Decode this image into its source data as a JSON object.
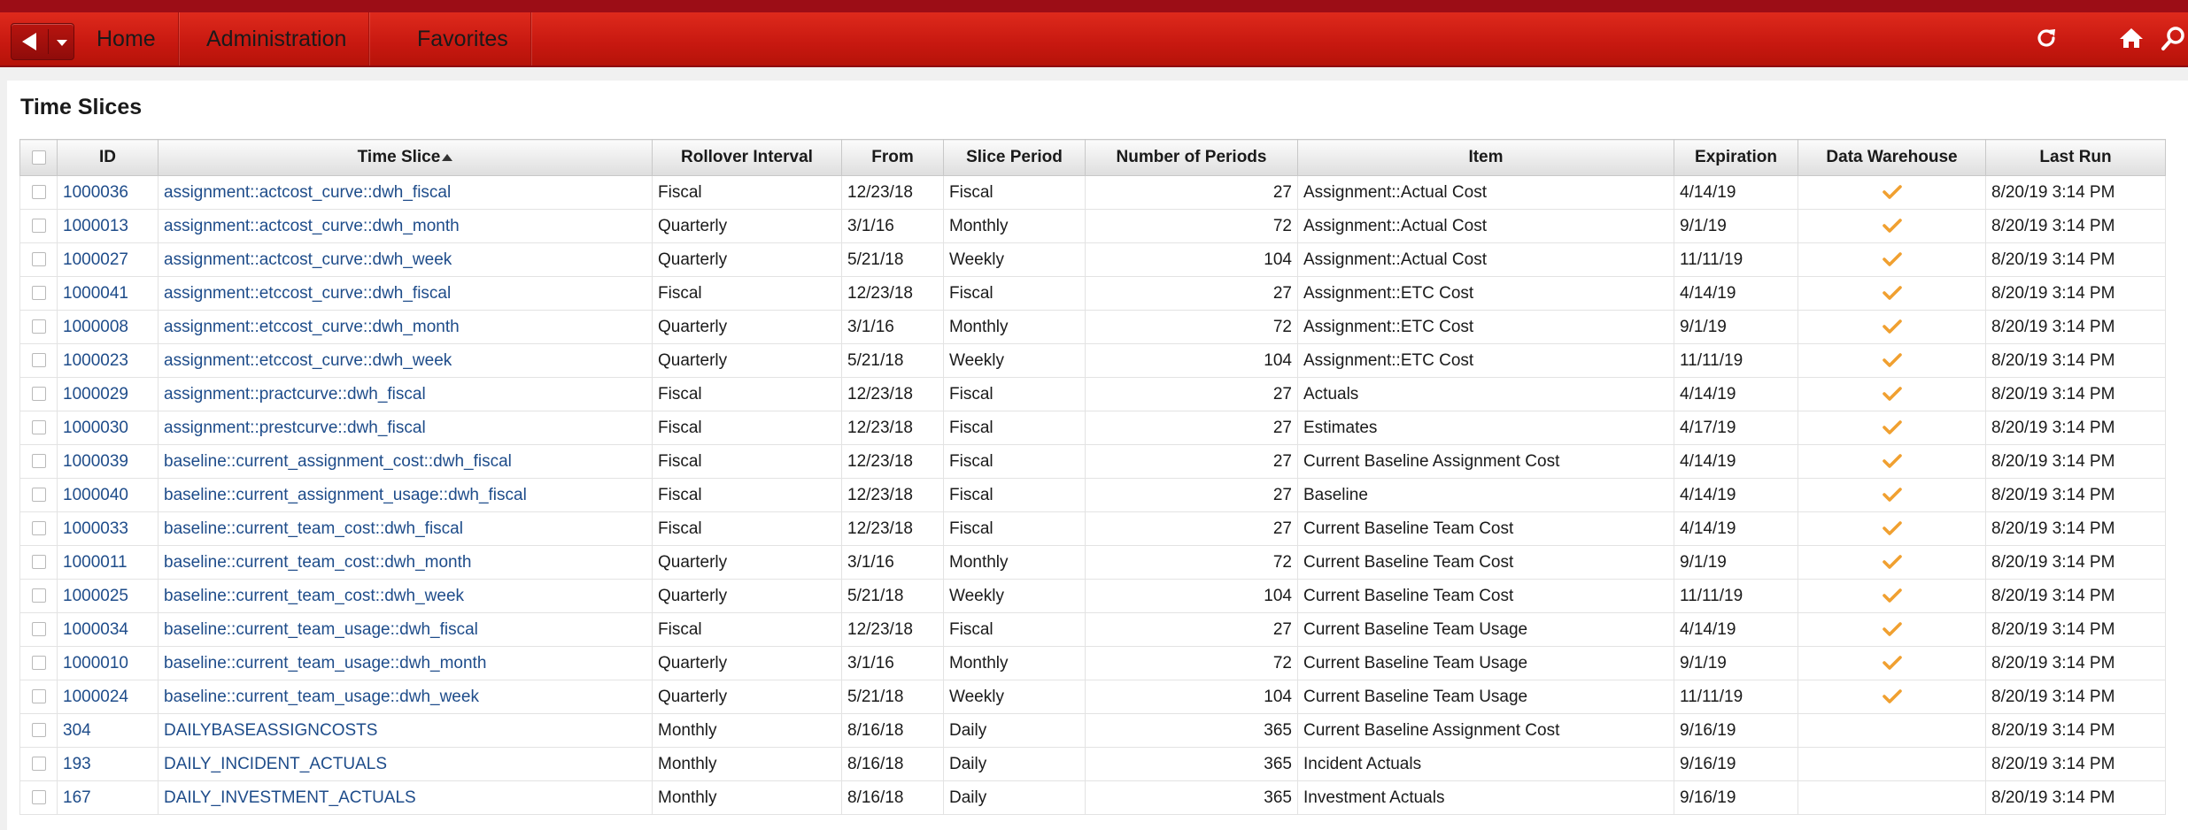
{
  "nav": {
    "items": [
      "Home",
      "Administration",
      "Favorites"
    ]
  },
  "page": {
    "title": "Time Slices"
  },
  "table": {
    "columns": [
      "ID",
      "Time Slice",
      "Rollover Interval",
      "From",
      "Slice Period",
      "Number of Periods",
      "Item",
      "Expiration",
      "Data Warehouse",
      "Last Run"
    ],
    "sort": {
      "column": "Time Slice",
      "direction": "ascending"
    },
    "check_color": "#f0a030",
    "rows": [
      {
        "id": "1000036",
        "slice": "assignment::actcost_curve::dwh_fiscal",
        "rollover": "Fiscal",
        "from": "12/23/18",
        "period": "Fiscal",
        "num": "27",
        "item": "Assignment::Actual Cost",
        "exp": "4/14/19",
        "dw": true,
        "last": "8/20/19 3:14 PM"
      },
      {
        "id": "1000013",
        "slice": "assignment::actcost_curve::dwh_month",
        "rollover": "Quarterly",
        "from": "3/1/16",
        "period": "Monthly",
        "num": "72",
        "item": "Assignment::Actual Cost",
        "exp": "9/1/19",
        "dw": true,
        "last": "8/20/19 3:14 PM"
      },
      {
        "id": "1000027",
        "slice": "assignment::actcost_curve::dwh_week",
        "rollover": "Quarterly",
        "from": "5/21/18",
        "period": "Weekly",
        "num": "104",
        "item": "Assignment::Actual Cost",
        "exp": "11/11/19",
        "dw": true,
        "last": "8/20/19 3:14 PM"
      },
      {
        "id": "1000041",
        "slice": "assignment::etccost_curve::dwh_fiscal",
        "rollover": "Fiscal",
        "from": "12/23/18",
        "period": "Fiscal",
        "num": "27",
        "item": "Assignment::ETC Cost",
        "exp": "4/14/19",
        "dw": true,
        "last": "8/20/19 3:14 PM"
      },
      {
        "id": "1000008",
        "slice": "assignment::etccost_curve::dwh_month",
        "rollover": "Quarterly",
        "from": "3/1/16",
        "period": "Monthly",
        "num": "72",
        "item": "Assignment::ETC Cost",
        "exp": "9/1/19",
        "dw": true,
        "last": "8/20/19 3:14 PM"
      },
      {
        "id": "1000023",
        "slice": "assignment::etccost_curve::dwh_week",
        "rollover": "Quarterly",
        "from": "5/21/18",
        "period": "Weekly",
        "num": "104",
        "item": "Assignment::ETC Cost",
        "exp": "11/11/19",
        "dw": true,
        "last": "8/20/19 3:14 PM"
      },
      {
        "id": "1000029",
        "slice": "assignment::practcurve::dwh_fiscal",
        "rollover": "Fiscal",
        "from": "12/23/18",
        "period": "Fiscal",
        "num": "27",
        "item": "Actuals",
        "exp": "4/14/19",
        "dw": true,
        "last": "8/20/19 3:14 PM"
      },
      {
        "id": "1000030",
        "slice": "assignment::prestcurve::dwh_fiscal",
        "rollover": "Fiscal",
        "from": "12/23/18",
        "period": "Fiscal",
        "num": "27",
        "item": "Estimates",
        "exp": "4/17/19",
        "dw": true,
        "last": "8/20/19 3:14 PM"
      },
      {
        "id": "1000039",
        "slice": "baseline::current_assignment_cost::dwh_fiscal",
        "rollover": "Fiscal",
        "from": "12/23/18",
        "period": "Fiscal",
        "num": "27",
        "item": "Current Baseline Assignment Cost",
        "exp": "4/14/19",
        "dw": true,
        "last": "8/20/19 3:14 PM"
      },
      {
        "id": "1000040",
        "slice": "baseline::current_assignment_usage::dwh_fiscal",
        "rollover": "Fiscal",
        "from": "12/23/18",
        "period": "Fiscal",
        "num": "27",
        "item": "Baseline",
        "exp": "4/14/19",
        "dw": true,
        "last": "8/20/19 3:14 PM"
      },
      {
        "id": "1000033",
        "slice": "baseline::current_team_cost::dwh_fiscal",
        "rollover": "Fiscal",
        "from": "12/23/18",
        "period": "Fiscal",
        "num": "27",
        "item": "Current Baseline Team Cost",
        "exp": "4/14/19",
        "dw": true,
        "last": "8/20/19 3:14 PM"
      },
      {
        "id": "1000011",
        "slice": "baseline::current_team_cost::dwh_month",
        "rollover": "Quarterly",
        "from": "3/1/16",
        "period": "Monthly",
        "num": "72",
        "item": "Current Baseline Team Cost",
        "exp": "9/1/19",
        "dw": true,
        "last": "8/20/19 3:14 PM"
      },
      {
        "id": "1000025",
        "slice": "baseline::current_team_cost::dwh_week",
        "rollover": "Quarterly",
        "from": "5/21/18",
        "period": "Weekly",
        "num": "104",
        "item": "Current Baseline Team Cost",
        "exp": "11/11/19",
        "dw": true,
        "last": "8/20/19 3:14 PM"
      },
      {
        "id": "1000034",
        "slice": "baseline::current_team_usage::dwh_fiscal",
        "rollover": "Fiscal",
        "from": "12/23/18",
        "period": "Fiscal",
        "num": "27",
        "item": "Current Baseline Team Usage",
        "exp": "4/14/19",
        "dw": true,
        "last": "8/20/19 3:14 PM"
      },
      {
        "id": "1000010",
        "slice": "baseline::current_team_usage::dwh_month",
        "rollover": "Quarterly",
        "from": "3/1/16",
        "period": "Monthly",
        "num": "72",
        "item": "Current Baseline Team Usage",
        "exp": "9/1/19",
        "dw": true,
        "last": "8/20/19 3:14 PM"
      },
      {
        "id": "1000024",
        "slice": "baseline::current_team_usage::dwh_week",
        "rollover": "Quarterly",
        "from": "5/21/18",
        "period": "Weekly",
        "num": "104",
        "item": "Current Baseline Team Usage",
        "exp": "11/11/19",
        "dw": true,
        "last": "8/20/19 3:14 PM"
      },
      {
        "id": "304",
        "slice": "DAILYBASEASSIGNCOSTS",
        "rollover": "Monthly",
        "from": "8/16/18",
        "period": "Daily",
        "num": "365",
        "item": "Current Baseline Assignment Cost",
        "exp": "9/16/19",
        "dw": false,
        "last": "8/20/19 3:14 PM"
      },
      {
        "id": "193",
        "slice": "DAILY_INCIDENT_ACTUALS",
        "rollover": "Monthly",
        "from": "8/16/18",
        "period": "Daily",
        "num": "365",
        "item": "Incident Actuals",
        "exp": "9/16/19",
        "dw": false,
        "last": "8/20/19 3:14 PM"
      },
      {
        "id": "167",
        "slice": "DAILY_INVESTMENT_ACTUALS",
        "rollover": "Monthly",
        "from": "8/16/18",
        "period": "Daily",
        "num": "365",
        "item": "Investment Actuals",
        "exp": "9/16/19",
        "dw": false,
        "last": "8/20/19 3:14 PM"
      }
    ]
  }
}
